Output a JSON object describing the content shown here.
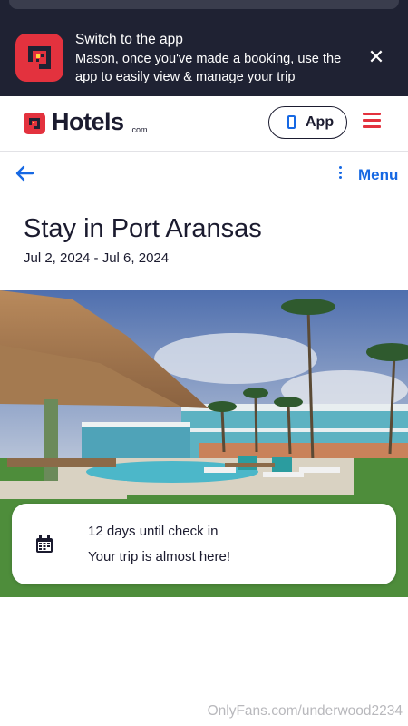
{
  "banner": {
    "title": "Switch to the app",
    "message": "Mason, once you've made a booking, use the app to easily view & manage your trip",
    "close_glyph": "✕",
    "logo_icon": "hotels-app-icon"
  },
  "header": {
    "brand_name": "Hotels",
    "brand_suffix": ".com",
    "app_button_label": "App",
    "app_icon": "phone-icon",
    "menu_icon": "hamburger-icon",
    "accent_color": "#e3323e"
  },
  "nav": {
    "back_icon": "back-arrow-icon",
    "menu_label": "Menu",
    "link_color": "#1668e3"
  },
  "trip": {
    "title": "Stay in Port Aransas",
    "dates": "Jul 2, 2024 - Jul 6, 2024"
  },
  "countdown": {
    "icon": "calendar-icon",
    "title": "12 days until check in",
    "subtitle": "Your trip is almost here!"
  },
  "watermark": "OnlyFans.com/underwood2234"
}
